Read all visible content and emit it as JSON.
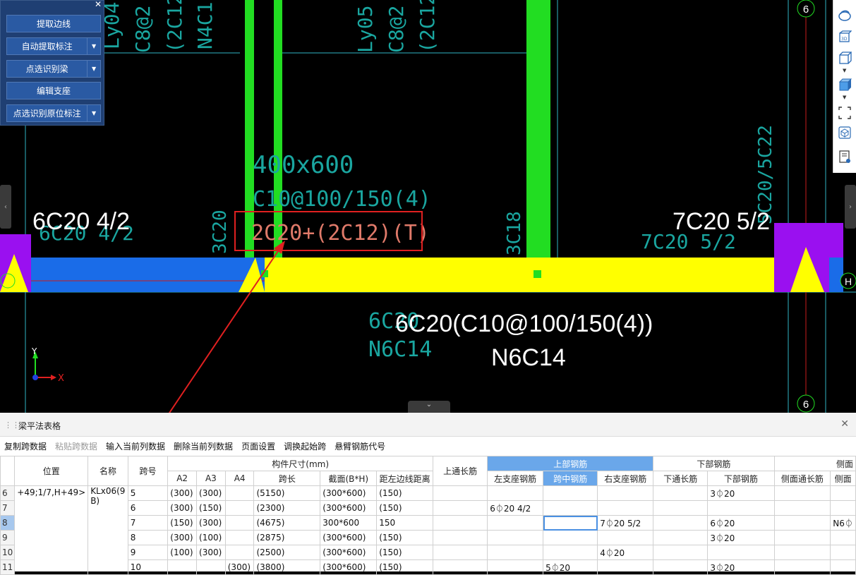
{
  "toolpanel": {
    "buttons": [
      {
        "label": "提取边线",
        "dropdown": false
      },
      {
        "label": "自动提取标注",
        "dropdown": true
      },
      {
        "label": "点选识别梁",
        "dropdown": true
      },
      {
        "label": "编辑支座",
        "dropdown": false
      },
      {
        "label": "点选识别原位标注",
        "dropdown": true
      }
    ]
  },
  "cad": {
    "axis_label_top": "6",
    "axis_label_bottom": "6",
    "axis_H": "H",
    "texts": {
      "t_lyo4": "Ly04",
      "t_c8a": "C8@2",
      "t_2c12a": "(2C12",
      "t_n4c": "N4C1",
      "t_lyo5": "Ly05",
      "t_c8b": "C8@2",
      "t_2c12b": "(2C12",
      "t_section": "400x600",
      "t_stirrup": "C10@100/150(4)",
      "t_top": "2C20+(2C12)(T)",
      "t_3c20": "3C20",
      "t_3c18": "3C18",
      "t_6c20_left": "6C20 4/2",
      "t_7c20_right": "7C20 5/2",
      "t_5c20v": "5C20/5C22",
      "t_6c20_bot": "6C20",
      "t_n6c14": "N6C14"
    },
    "overlay": {
      "left_label": "6C20 4/2",
      "right_label": "7C20 5/2",
      "bottom_label1": "6C20(C10@100/150(4))",
      "bottom_label2": "N6C14"
    },
    "axes": {
      "y": "Y",
      "x": "X"
    }
  },
  "panel": {
    "title": "梁平法表格",
    "toolbar": [
      {
        "label": "复制跨数据",
        "disabled": false
      },
      {
        "label": "粘贴跨数据",
        "disabled": true
      },
      {
        "label": "输入当前列数据",
        "disabled": false
      },
      {
        "label": "删除当前列数据",
        "disabled": false
      },
      {
        "label": "页面设置",
        "disabled": false
      },
      {
        "label": "调换起始跨",
        "disabled": false
      },
      {
        "label": "悬臂钢筋代号",
        "disabled": false
      }
    ],
    "headers": {
      "pos": "位置",
      "name": "名称",
      "span": "跨号",
      "dims": "构件尺寸(mm)",
      "a2": "A2",
      "a3": "A3",
      "a4": "A4",
      "len": "跨长",
      "sect": "截面(B*H)",
      "dist": "距左边线距离",
      "toplong": "上通长筋",
      "topbar": "上部钢筋",
      "left": "左支座钢筋",
      "mid": "跨中钢筋",
      "right": "右支座钢筋",
      "botbar": "下部钢筋",
      "botlong": "下通长筋",
      "bot": "下部钢筋",
      "sidelong": "侧面通长筋",
      "side": "侧面"
    },
    "pos_value": "+49;1/7,H+49>",
    "name_value": "KLx06(9B)",
    "rows": [
      {
        "rn": "6",
        "span": "5",
        "a2": "(300)",
        "a3": "(300)",
        "a4": "",
        "len": "(5150)",
        "sect": "(300*600)",
        "dist": "(150)",
        "toplong": "",
        "left": "",
        "mid": "",
        "right": "",
        "botlong": "",
        "bot": "3⏀20",
        "sidelong": "",
        "side": ""
      },
      {
        "rn": "7",
        "span": "6",
        "a2": "(300)",
        "a3": "(150)",
        "a4": "",
        "len": "(2300)",
        "sect": "(300*600)",
        "dist": "(150)",
        "toplong": "",
        "left": "6⏀20 4/2",
        "mid": "",
        "right": "",
        "botlong": "",
        "bot": "",
        "sidelong": "",
        "side": ""
      },
      {
        "rn": "8",
        "span": "7",
        "a2": "(150)",
        "a3": "(300)",
        "a4": "",
        "len": "(4675)",
        "sect": "300*600",
        "dist": "150",
        "toplong": "",
        "left": "",
        "mid": "",
        "right": "7⏀20 5/2",
        "botlong": "",
        "bot": "6⏀20",
        "sidelong": "",
        "side": "N6⏀"
      },
      {
        "rn": "9",
        "span": "8",
        "a2": "(300)",
        "a3": "(100)",
        "a4": "",
        "len": "(2875)",
        "sect": "(300*600)",
        "dist": "(150)",
        "toplong": "",
        "left": "",
        "mid": "",
        "right": "",
        "botlong": "",
        "bot": "3⏀20",
        "sidelong": "",
        "side": ""
      },
      {
        "rn": "10",
        "span": "9",
        "a2": "(100)",
        "a3": "(300)",
        "a4": "",
        "len": "(2500)",
        "sect": "(300*600)",
        "dist": "(150)",
        "toplong": "",
        "left": "",
        "mid": "",
        "right": "4⏀20",
        "botlong": "",
        "bot": "",
        "sidelong": "",
        "side": ""
      },
      {
        "rn": "11",
        "span": "10",
        "a2": "",
        "a3": "",
        "a4": "(300)",
        "len": "(3800)",
        "sect": "(300*600)",
        "dist": "(150)",
        "toplong": "",
        "left": "",
        "mid": "5⏀20",
        "right": "",
        "botlong": "",
        "bot": "3⏀20",
        "sidelong": "",
        "side": ""
      }
    ]
  }
}
